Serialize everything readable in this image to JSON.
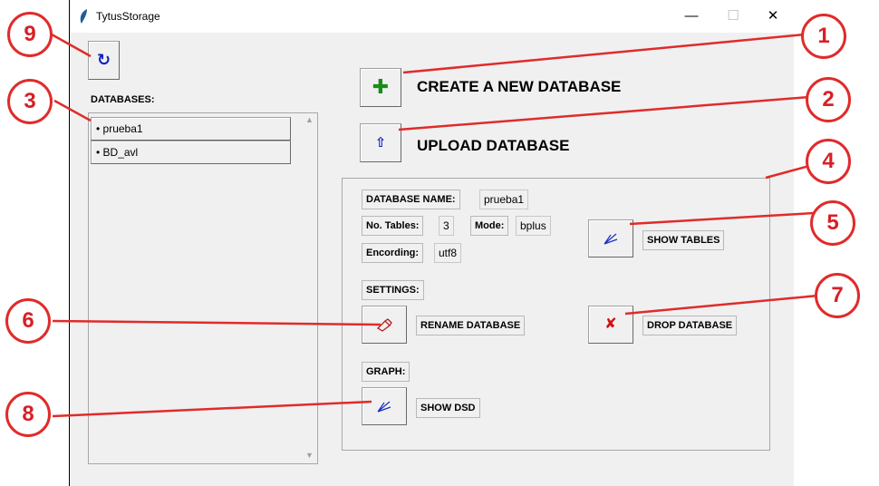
{
  "window": {
    "title": "TytusStorage",
    "minimize_glyph": "—",
    "maximize_glyph": "☐",
    "close_glyph": "✕"
  },
  "toolbar": {
    "refresh_glyph": "↻"
  },
  "sidebar": {
    "label": "DATABASES:",
    "items": [
      {
        "label": "• prueba1"
      },
      {
        "label": "• BD_avl"
      }
    ]
  },
  "actions": {
    "create_glyph": "✚",
    "create_label": "CREATE A NEW DATABASE",
    "upload_glyph": "⇧",
    "upload_label": "UPLOAD DATABASE"
  },
  "details": {
    "db_name_label": "DATABASE NAME:",
    "db_name_value": "prueba1",
    "tables_label": "No. Tables:",
    "tables_value": "3",
    "mode_label": "Mode:",
    "mode_value": "bplus",
    "encoding_label": "Encording:",
    "encoding_value": "utf8",
    "show_tables_label": "SHOW TABLES",
    "settings_label": "SETTINGS:",
    "rename_label": "RENAME DATABASE",
    "drop_glyph": "✘",
    "drop_label": "DROP DATABASE",
    "graph_label": "GRAPH:",
    "show_dsd_label": "SHOW DSD"
  },
  "annotations": [
    "1",
    "2",
    "3",
    "4",
    "5",
    "6",
    "7",
    "8",
    "9"
  ],
  "colors": {
    "annotation_red": "#e02b2b",
    "create_green": "#1a8c1a",
    "icon_blue": "#1020c0"
  }
}
